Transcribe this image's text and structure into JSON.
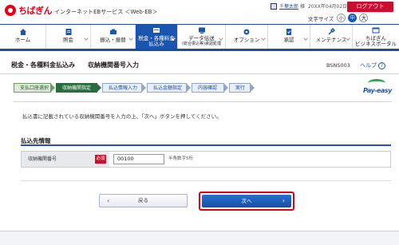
{
  "header": {
    "brand": "ちばぎん",
    "service_name": "インターネットEBサービス ＜Web-EB＞",
    "user_name": "千葉太郎",
    "user_suffix": "様",
    "login_time": "20XX年04月02日 10時00分00秒",
    "logout_label": "ログアウト",
    "font_size_label": "文字サイズ",
    "font_small": "小",
    "font_mid": "中",
    "font_big": "大"
  },
  "nav": {
    "items": [
      {
        "label1": "ホーム",
        "label2": "",
        "icon": "home-icon"
      },
      {
        "label1": "照会",
        "label2": "",
        "icon": "inquiry-icon"
      },
      {
        "label1": "振込・振替",
        "label2": "",
        "icon": "transfer-icon"
      },
      {
        "label1": "税金・各種料金",
        "label2": "払込み",
        "icon": "tax-payment-icon"
      },
      {
        "label1": "データ伝送",
        "label2": "(総合振込等)承認処理",
        "icon": "data-transmission-icon"
      },
      {
        "label1": "オプション",
        "label2": "",
        "icon": "option-icon"
      },
      {
        "label1": "承認",
        "label2": "",
        "icon": "approval-icon"
      },
      {
        "label1": "メンテナンス",
        "label2": "",
        "icon": "maintenance-icon"
      },
      {
        "label1": "ちばぎん",
        "label2": "ビジネスポータル",
        "icon": "portal-icon"
      }
    ],
    "active_index": 3
  },
  "page": {
    "title": "税金・各種料金払込み",
    "subtitle": "収納機関番号入力",
    "screen_id": "BSNS003",
    "help_label": "ヘルプ"
  },
  "steps": [
    "支払口座選択",
    "収納機関指定",
    "払込情報入力",
    "払込金額指定",
    "内容確認",
    "実行"
  ],
  "instruction": "払込書に記載されている収納機関番号を入力の上、「次へ」ボタンを押してください。",
  "section": {
    "title": "払込先情報",
    "field_label": "収納機関番号",
    "required_label": "必須",
    "field_value": "00100",
    "field_hint": "半角数字5桁"
  },
  "buttons": {
    "back": "戻る",
    "next": "次へ"
  },
  "payeasy_label": "Pay-easy",
  "colors": {
    "brand_red": "#e60012",
    "primary_blue": "#1a56b0",
    "active_step_green": "#2a6c3e",
    "highlight_red": "#e0001a"
  }
}
